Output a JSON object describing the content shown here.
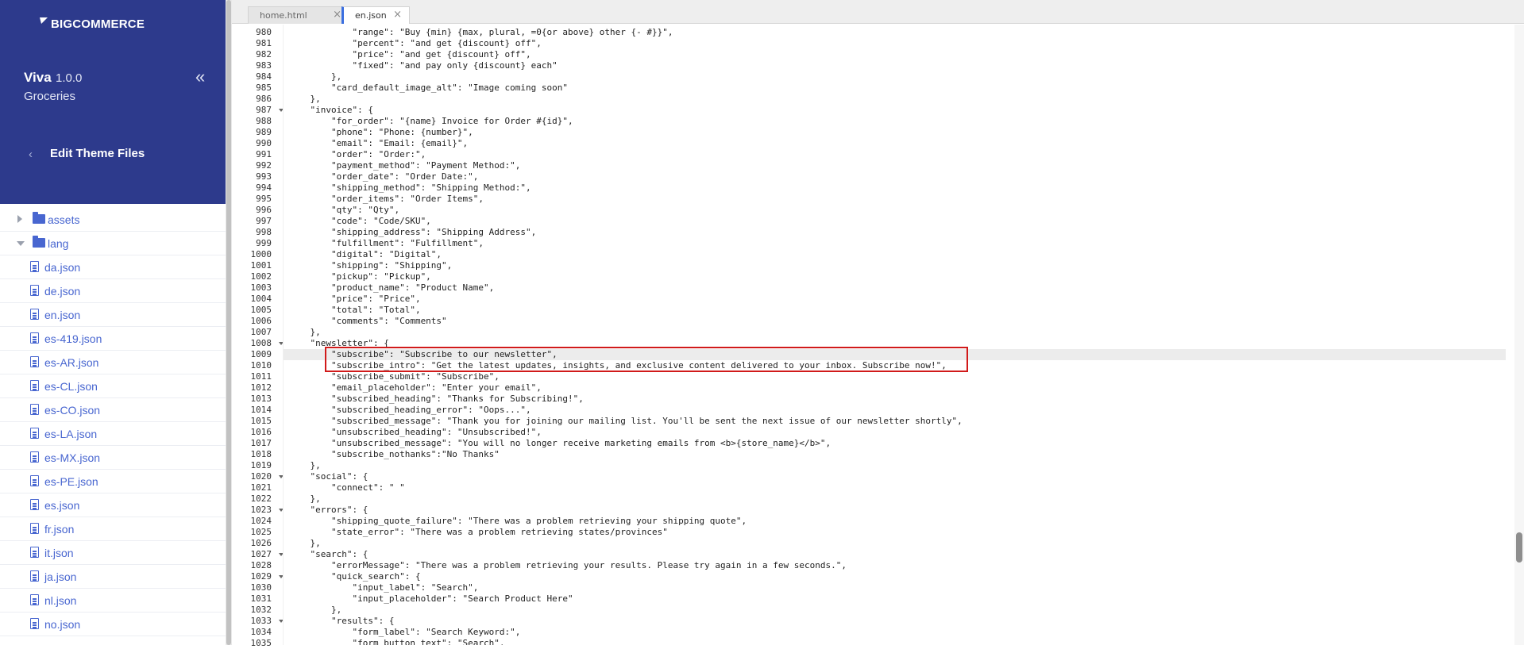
{
  "sidebar": {
    "logo_text": "BIGCOMMERCE",
    "theme": {
      "name": "Viva",
      "version": "1.0.0",
      "variant": "Groceries"
    },
    "collapse_icon": "«",
    "back_icon": "‹",
    "edit_title": "Edit Theme Files",
    "tree": [
      {
        "label": "assets",
        "kind": "folder",
        "state": "collapsed"
      },
      {
        "label": "lang",
        "kind": "folder",
        "state": "expanded"
      },
      {
        "label": "da.json",
        "kind": "file"
      },
      {
        "label": "de.json",
        "kind": "file"
      },
      {
        "label": "en.json",
        "kind": "file"
      },
      {
        "label": "es-419.json",
        "kind": "file"
      },
      {
        "label": "es-AR.json",
        "kind": "file"
      },
      {
        "label": "es-CL.json",
        "kind": "file"
      },
      {
        "label": "es-CO.json",
        "kind": "file"
      },
      {
        "label": "es-LA.json",
        "kind": "file"
      },
      {
        "label": "es-MX.json",
        "kind": "file"
      },
      {
        "label": "es-PE.json",
        "kind": "file"
      },
      {
        "label": "es.json",
        "kind": "file"
      },
      {
        "label": "fr.json",
        "kind": "file"
      },
      {
        "label": "it.json",
        "kind": "file"
      },
      {
        "label": "ja.json",
        "kind": "file"
      },
      {
        "label": "nl.json",
        "kind": "file"
      },
      {
        "label": "no.json",
        "kind": "file"
      }
    ]
  },
  "editor": {
    "tabs": [
      {
        "label": "home.html",
        "active": false,
        "close": "×"
      },
      {
        "label": "en.json",
        "active": true,
        "close": "×"
      }
    ],
    "active_line": 1009,
    "highlighted_lines": [
      1009,
      1010
    ],
    "lines": [
      {
        "n": "980",
        "fold": false,
        "text": "            \"range\": \"Buy {min} {max, plural, =0{or above} other {- #}}\","
      },
      {
        "n": "981",
        "fold": false,
        "text": "            \"percent\": \"and get {discount} off\","
      },
      {
        "n": "982",
        "fold": false,
        "text": "            \"price\": \"and get {discount} off\","
      },
      {
        "n": "983",
        "fold": false,
        "text": "            \"fixed\": \"and pay only {discount} each\""
      },
      {
        "n": "984",
        "fold": false,
        "text": "        },"
      },
      {
        "n": "985",
        "fold": false,
        "text": "        \"card_default_image_alt\": \"Image coming soon\""
      },
      {
        "n": "986",
        "fold": false,
        "text": "    },"
      },
      {
        "n": "987",
        "fold": true,
        "text": "    \"invoice\": {"
      },
      {
        "n": "988",
        "fold": false,
        "text": "        \"for_order\": \"{name} Invoice for Order #{id}\","
      },
      {
        "n": "989",
        "fold": false,
        "text": "        \"phone\": \"Phone: {number}\","
      },
      {
        "n": "990",
        "fold": false,
        "text": "        \"email\": \"Email: {email}\","
      },
      {
        "n": "991",
        "fold": false,
        "text": "        \"order\": \"Order:\","
      },
      {
        "n": "992",
        "fold": false,
        "text": "        \"payment_method\": \"Payment Method:\","
      },
      {
        "n": "993",
        "fold": false,
        "text": "        \"order_date\": \"Order Date:\","
      },
      {
        "n": "994",
        "fold": false,
        "text": "        \"shipping_method\": \"Shipping Method:\","
      },
      {
        "n": "995",
        "fold": false,
        "text": "        \"order_items\": \"Order Items\","
      },
      {
        "n": "996",
        "fold": false,
        "text": "        \"qty\": \"Qty\","
      },
      {
        "n": "997",
        "fold": false,
        "text": "        \"code\": \"Code/SKU\","
      },
      {
        "n": "998",
        "fold": false,
        "text": "        \"shipping_address\": \"Shipping Address\","
      },
      {
        "n": "999",
        "fold": false,
        "text": "        \"fulfillment\": \"Fulfillment\","
      },
      {
        "n": "1000",
        "fold": false,
        "text": "        \"digital\": \"Digital\","
      },
      {
        "n": "1001",
        "fold": false,
        "text": "        \"shipping\": \"Shipping\","
      },
      {
        "n": "1002",
        "fold": false,
        "text": "        \"pickup\": \"Pickup\","
      },
      {
        "n": "1003",
        "fold": false,
        "text": "        \"product_name\": \"Product Name\","
      },
      {
        "n": "1004",
        "fold": false,
        "text": "        \"price\": \"Price\","
      },
      {
        "n": "1005",
        "fold": false,
        "text": "        \"total\": \"Total\","
      },
      {
        "n": "1006",
        "fold": false,
        "text": "        \"comments\": \"Comments\""
      },
      {
        "n": "1007",
        "fold": false,
        "text": "    },"
      },
      {
        "n": "1008",
        "fold": true,
        "text": "    \"newsletter\": {"
      },
      {
        "n": "1009",
        "fold": false,
        "text": "        \"subscribe\": \"Subscribe to our newsletter\","
      },
      {
        "n": "1010",
        "fold": false,
        "text": "        \"subscribe_intro\": \"Get the latest updates, insights, and exclusive content delivered to your inbox. Subscribe now!\","
      },
      {
        "n": "1011",
        "fold": false,
        "text": "        \"subscribe_submit\": \"Subscribe\","
      },
      {
        "n": "1012",
        "fold": false,
        "text": "        \"email_placeholder\": \"Enter your email\","
      },
      {
        "n": "1013",
        "fold": false,
        "text": "        \"subscribed_heading\": \"Thanks for Subscribing!\","
      },
      {
        "n": "1014",
        "fold": false,
        "text": "        \"subscribed_heading_error\": \"Oops...\","
      },
      {
        "n": "1015",
        "fold": false,
        "text": "        \"subscribed_message\": \"Thank you for joining our mailing list. You'll be sent the next issue of our newsletter shortly\","
      },
      {
        "n": "1016",
        "fold": false,
        "text": "        \"unsubscribed_heading\": \"Unsubscribed!\","
      },
      {
        "n": "1017",
        "fold": false,
        "text": "        \"unsubscribed_message\": \"You will no longer receive marketing emails from <b>{store_name}</b>\","
      },
      {
        "n": "1018",
        "fold": false,
        "text": "        \"subscribe_nothanks\":\"No Thanks\""
      },
      {
        "n": "1019",
        "fold": false,
        "text": "    },"
      },
      {
        "n": "1020",
        "fold": true,
        "text": "    \"social\": {"
      },
      {
        "n": "1021",
        "fold": false,
        "text": "        \"connect\": \" \""
      },
      {
        "n": "1022",
        "fold": false,
        "text": "    },"
      },
      {
        "n": "1023",
        "fold": true,
        "text": "    \"errors\": {"
      },
      {
        "n": "1024",
        "fold": false,
        "text": "        \"shipping_quote_failure\": \"There was a problem retrieving your shipping quote\","
      },
      {
        "n": "1025",
        "fold": false,
        "text": "        \"state_error\": \"There was a problem retrieving states/provinces\""
      },
      {
        "n": "1026",
        "fold": false,
        "text": "    },"
      },
      {
        "n": "1027",
        "fold": true,
        "text": "    \"search\": {"
      },
      {
        "n": "1028",
        "fold": false,
        "text": "        \"errorMessage\": \"There was a problem retrieving your results. Please try again in a few seconds.\","
      },
      {
        "n": "1029",
        "fold": true,
        "text": "        \"quick_search\": {"
      },
      {
        "n": "1030",
        "fold": false,
        "text": "            \"input_label\": \"Search\","
      },
      {
        "n": "1031",
        "fold": false,
        "text": "            \"input_placeholder\": \"Search Product Here\""
      },
      {
        "n": "1032",
        "fold": false,
        "text": "        },"
      },
      {
        "n": "1033",
        "fold": true,
        "text": "        \"results\": {"
      },
      {
        "n": "1034",
        "fold": false,
        "text": "            \"form_label\": \"Search Keyword:\","
      },
      {
        "n": "1035",
        "fold": false,
        "text": "            \"form_button_text\": \"Search\","
      }
    ]
  }
}
